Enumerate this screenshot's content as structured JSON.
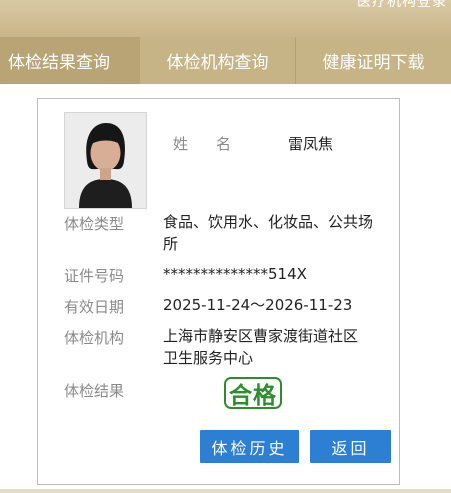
{
  "header": {
    "top_link": "医疗机构登录"
  },
  "nav": {
    "tabs": [
      "体检结果查询",
      "体检机构查询",
      "健康证明下载"
    ]
  },
  "card": {
    "name_label": "姓名",
    "name": "雷凤焦",
    "fields": [
      {
        "label": "体检类型",
        "value": "食品、饮用水、化妆品、公共场所"
      },
      {
        "label": "证件号码",
        "value": "**************514X"
      },
      {
        "label": "有效日期",
        "value": "2025-11-24～2026-11-23"
      },
      {
        "label": "体检机构",
        "value": "上海市静安区曹家渡街道社区卫生服务中心"
      },
      {
        "label": "体检结果",
        "value": ""
      }
    ],
    "result_stamp": "合格",
    "buttons": {
      "history": "体检历史",
      "back": "返回"
    }
  },
  "colors": {
    "nav_bg": "#c6b386",
    "button_blue": "#2d7fd3",
    "stamp_green": "#2e8b2e"
  }
}
